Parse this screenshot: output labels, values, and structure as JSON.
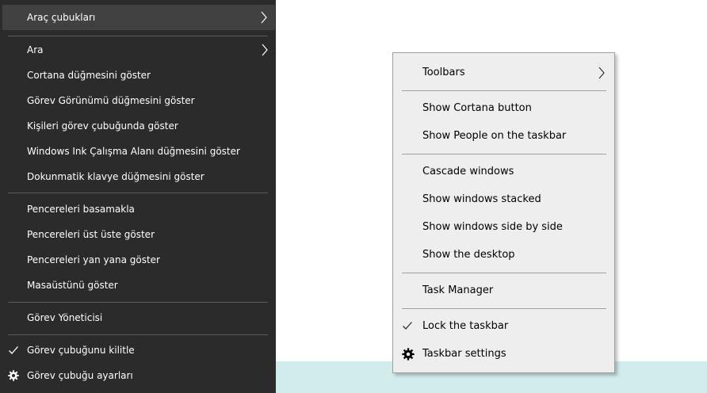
{
  "dark_menu": {
    "items": [
      {
        "label": "Araç çubukları",
        "submenu": true,
        "highlighted": true
      },
      {
        "label": "Ara",
        "submenu": true
      },
      {
        "label": "Cortana düğmesini göster"
      },
      {
        "label": "Görev Görünümü düğmesini göster"
      },
      {
        "label": "Kişileri görev çubuğunda göster"
      },
      {
        "label": "Windows Ink Çalışma Alanı düğmesini göster"
      },
      {
        "label": "Dokunmatik klavye düğmesini göster"
      },
      {
        "label": "Pencereleri basamakla"
      },
      {
        "label": "Pencereleri üst üste göster"
      },
      {
        "label": "Pencereleri yan yana göster"
      },
      {
        "label": "Masaüstünü göster"
      },
      {
        "label": "Görev Yöneticisi"
      },
      {
        "label": "Görev çubuğunu kilitle",
        "checked": true,
        "icon": "checkmark-icon"
      },
      {
        "label": "Görev çubuğu ayarları",
        "icon": "gear-icon"
      }
    ]
  },
  "light_menu": {
    "items": [
      {
        "label": "Toolbars",
        "submenu": true
      },
      {
        "label": "Show Cortana button"
      },
      {
        "label": "Show People on the taskbar"
      },
      {
        "label": "Cascade windows"
      },
      {
        "label": "Show windows stacked"
      },
      {
        "label": "Show windows side by side"
      },
      {
        "label": "Show the desktop"
      },
      {
        "label": "Task Manager"
      },
      {
        "label": "Lock the taskbar",
        "checked": true,
        "icon": "checkmark-icon"
      },
      {
        "label": "Taskbar settings",
        "icon": "gear-icon"
      }
    ]
  },
  "colors": {
    "dark_menu_bg": "#2b2b2b",
    "dark_highlight": "#414141",
    "light_menu_bg": "#eeeeee",
    "desktop_band": "#d2ecec"
  }
}
